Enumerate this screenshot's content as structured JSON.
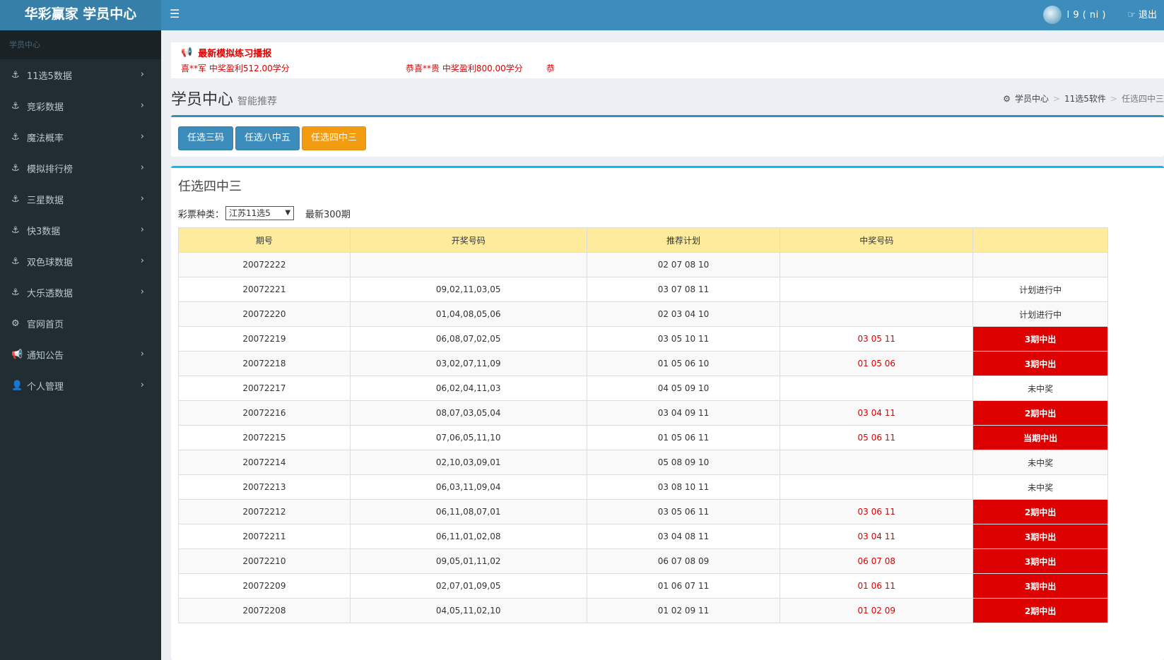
{
  "header": {
    "logo": "华彩赢家 学员中心",
    "username": "l        9 (     ni )",
    "logout_label": "退出"
  },
  "sidebar": {
    "section_label": "学员中心",
    "items": [
      {
        "label": "11选5数据",
        "icon": "anchor-icon",
        "has_children": true
      },
      {
        "label": "竞彩数据",
        "icon": "anchor-icon",
        "has_children": true
      },
      {
        "label": "魔法概率",
        "icon": "anchor-icon",
        "has_children": true
      },
      {
        "label": "模拟排行榜",
        "icon": "anchor-icon",
        "has_children": true
      },
      {
        "label": "三星数据",
        "icon": "anchor-icon",
        "has_children": true
      },
      {
        "label": "快3数据",
        "icon": "anchor-icon",
        "has_children": true
      },
      {
        "label": "双色球数据",
        "icon": "anchor-icon",
        "has_children": true
      },
      {
        "label": "大乐透数据",
        "icon": "anchor-icon",
        "has_children": true
      },
      {
        "label": "官网首页",
        "icon": "dashboard-icon",
        "has_children": false
      },
      {
        "label": "通知公告",
        "icon": "bullhorn-icon",
        "has_children": true
      },
      {
        "label": "个人管理",
        "icon": "user-icon",
        "has_children": true
      }
    ]
  },
  "broadcast": {
    "title": "最新模拟练习播报",
    "messages": [
      "喜**军 中奖盈利512.00学分",
      "恭喜**贵 中奖盈利800.00学分",
      "恭"
    ]
  },
  "page": {
    "title": "学员中心",
    "subtitle": "智能推荐",
    "breadcrumb": [
      "学员中心",
      "11选5软件",
      "任选四中三"
    ]
  },
  "plan_buttons": [
    {
      "label": "任选三码",
      "active": false
    },
    {
      "label": "任选八中五",
      "active": false
    },
    {
      "label": "任选四中三",
      "active": true
    }
  ],
  "panel": {
    "title": "任选四中三",
    "lottery_type_label": "彩票种类：",
    "lottery_type_value": "江苏11选5",
    "latest_label": "最新300期"
  },
  "table": {
    "columns": [
      "期号",
      "开奖号码",
      "推荐计划",
      "中奖号码",
      ""
    ],
    "rows": [
      {
        "issue": "20072222",
        "draw": "",
        "plan": "02 07 08 10",
        "win": "",
        "status": "",
        "hit": false
      },
      {
        "issue": "20072221",
        "draw": "09,02,11,03,05",
        "plan": "03 07 08 11",
        "win": "",
        "status": "计划进行中",
        "hit": false
      },
      {
        "issue": "20072220",
        "draw": "01,04,08,05,06",
        "plan": "02 03 04 10",
        "win": "",
        "status": "计划进行中",
        "hit": false
      },
      {
        "issue": "20072219",
        "draw": "06,08,07,02,05",
        "plan": "03 05 10 11",
        "win": "03 05 11",
        "status": "3期中出",
        "hit": true
      },
      {
        "issue": "20072218",
        "draw": "03,02,07,11,09",
        "plan": "01 05 06 10",
        "win": "01 05 06",
        "status": "3期中出",
        "hit": true
      },
      {
        "issue": "20072217",
        "draw": "06,02,04,11,03",
        "plan": "04 05 09 10",
        "win": "",
        "status": "未中奖",
        "hit": false
      },
      {
        "issue": "20072216",
        "draw": "08,07,03,05,04",
        "plan": "03 04 09 11",
        "win": "03 04 11",
        "status": "2期中出",
        "hit": true
      },
      {
        "issue": "20072215",
        "draw": "07,06,05,11,10",
        "plan": "01 05 06 11",
        "win": "05 06 11",
        "status": "当期中出",
        "hit": true
      },
      {
        "issue": "20072214",
        "draw": "02,10,03,09,01",
        "plan": "05 08 09 10",
        "win": "",
        "status": "未中奖",
        "hit": false
      },
      {
        "issue": "20072213",
        "draw": "06,03,11,09,04",
        "plan": "03 08 10 11",
        "win": "",
        "status": "未中奖",
        "hit": false
      },
      {
        "issue": "20072212",
        "draw": "06,11,08,07,01",
        "plan": "03 05 06 11",
        "win": "03 06 11",
        "status": "2期中出",
        "hit": true
      },
      {
        "issue": "20072211",
        "draw": "06,11,01,02,08",
        "plan": "03 04 08 11",
        "win": "03 04 11",
        "status": "3期中出",
        "hit": true
      },
      {
        "issue": "20072210",
        "draw": "09,05,01,11,02",
        "plan": "06 07 08 09",
        "win": "06 07 08",
        "status": "3期中出",
        "hit": true
      },
      {
        "issue": "20072209",
        "draw": "02,07,01,09,05",
        "plan": "01 06 07 11",
        "win": "01 06 11",
        "status": "3期中出",
        "hit": true
      },
      {
        "issue": "20072208",
        "draw": "04,05,11,02,10",
        "plan": "01 02 09 11",
        "win": "01 02 09",
        "status": "2期中出",
        "hit": true
      }
    ]
  },
  "colors": {
    "header_bg": "#3c8dbc",
    "sidebar_bg": "#222d32",
    "accent_orange": "#f39c12",
    "hit_red": "#dd0000",
    "table_header": "#ffeb9c"
  }
}
